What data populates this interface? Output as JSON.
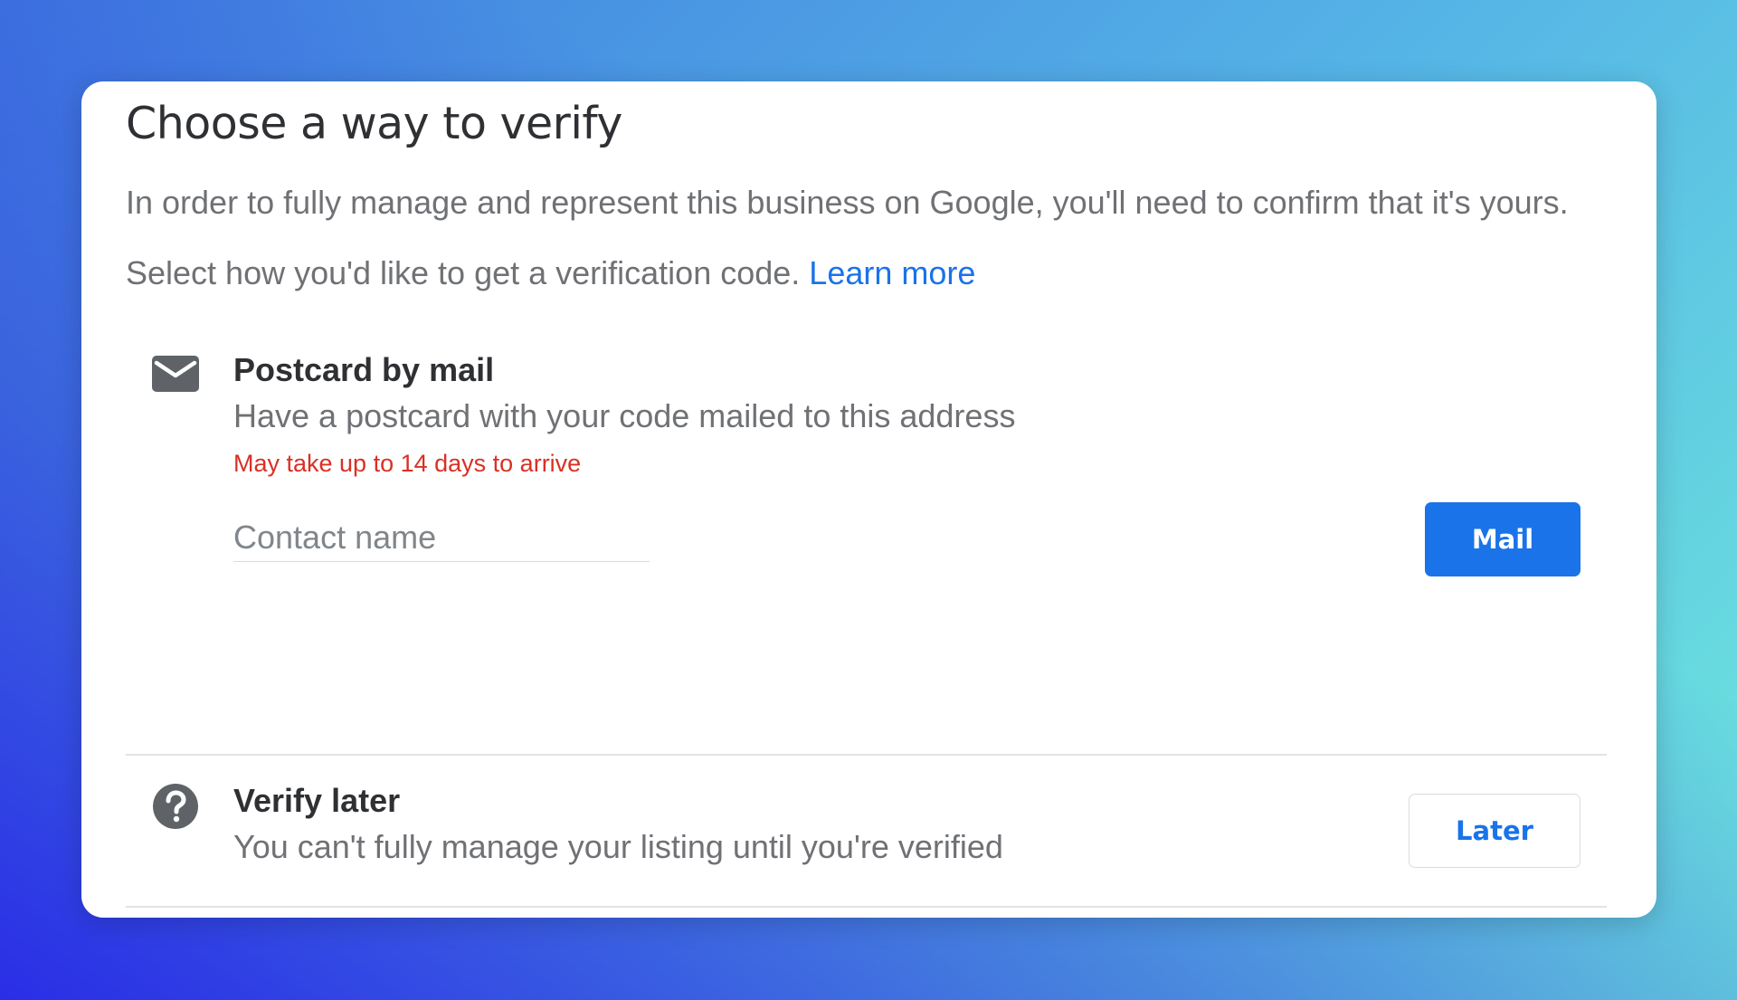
{
  "dialog": {
    "title": "Choose a way to verify",
    "intro": "In order to fully manage and represent this business on Google, you'll need to confirm that it's yours.",
    "select_text": "Select how you'd like to get a verification code. ",
    "learn_more": "Learn more"
  },
  "postcard": {
    "icon": "mail-icon",
    "title": "Postcard by mail",
    "description": "Have a postcard with your code mailed to this address",
    "warning": "May take up to 14 days to arrive",
    "contact_name": {
      "value": "",
      "placeholder": "Contact name"
    },
    "button_label": "Mail"
  },
  "verify_later": {
    "icon": "help-icon",
    "title": "Verify later",
    "description": "You can't fully manage your listing until you're verified",
    "button_label": "Later"
  },
  "colors": {
    "primary_blue": "#1a73e8",
    "warning_red": "#d93025",
    "title_text": "#2f3033",
    "secondary_text": "#6f7175",
    "icon_gray": "#5f6368"
  }
}
